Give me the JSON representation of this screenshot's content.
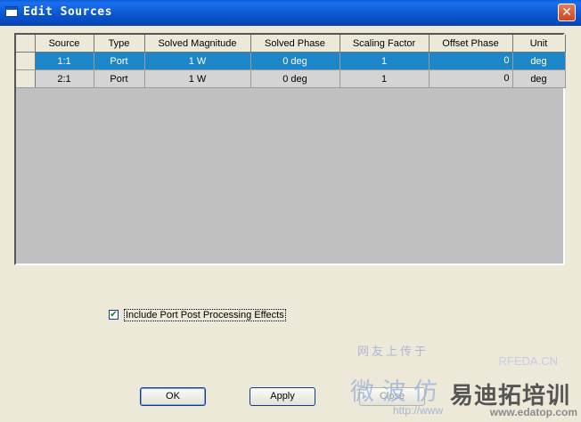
{
  "window": {
    "title": "Edit Sources",
    "close_glyph": "✕"
  },
  "table": {
    "columns": [
      "Source",
      "Type",
      "Solved Magnitude",
      "Solved Phase",
      "Scaling Factor",
      "Offset Phase",
      "Unit"
    ],
    "rows": [
      {
        "source": "1:1",
        "type": "Port",
        "magnitude": "1 W",
        "phase": "0 deg",
        "scaling": "1",
        "offset": "0",
        "unit": "deg",
        "selected": true
      },
      {
        "source": "2:1",
        "type": "Port",
        "magnitude": "1 W",
        "phase": "0 deg",
        "scaling": "1",
        "offset": "0",
        "unit": "deg",
        "selected": false
      }
    ]
  },
  "option": {
    "label": "Include Port Post Processing Effects",
    "checked": true,
    "check_glyph": "✔"
  },
  "buttons": {
    "ok": "OK",
    "apply": "Apply",
    "close": "Close"
  },
  "watermark": {
    "top": "网友上传于",
    "rfeda": "RFEDA.CN",
    "big1": "微 波 仿",
    "big2": "易迪拓培训",
    "url1": "http://www",
    "url2": "www.edatop.com"
  }
}
